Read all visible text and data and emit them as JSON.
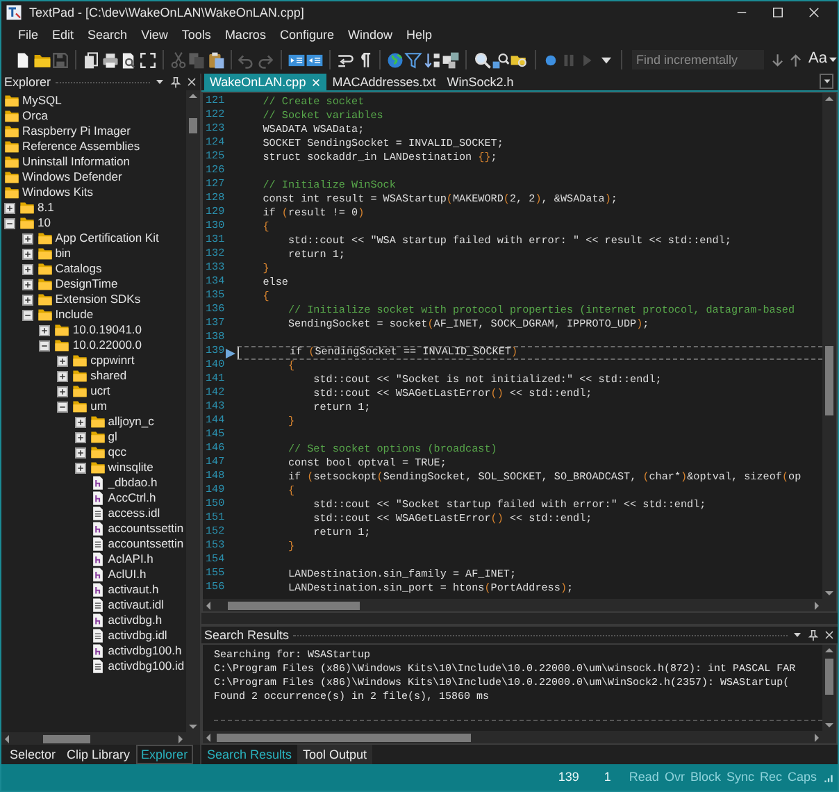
{
  "window": {
    "title": "TextPad - [C:\\dev\\WakeOnLAN\\WakeOnLAN.cpp]"
  },
  "menu": [
    "File",
    "Edit",
    "Search",
    "View",
    "Tools",
    "Macros",
    "Configure",
    "Window",
    "Help"
  ],
  "toolbar": {
    "groups": [
      [
        {
          "disabled": false
        },
        {
          "disabled": false
        },
        {
          "disabled": true
        }
      ],
      [
        {
          "disabled": false
        },
        {
          "disabled": false
        },
        {
          "disabled": false
        },
        {
          "disabled": false
        }
      ],
      [
        {
          "disabled": true
        },
        {
          "disabled": true
        },
        {
          "disabled": false
        }
      ],
      [
        {
          "disabled": true
        },
        {
          "disabled": true
        }
      ],
      [
        {
          "disabled": false
        },
        {
          "disabled": false
        }
      ],
      [
        {
          "disabled": false
        },
        {
          "disabled": false
        }
      ],
      [
        {
          "disabled": false
        },
        {
          "disabled": false
        },
        {
          "disabled": false
        },
        {
          "disabled": false
        }
      ],
      [
        {
          "disabled": false
        },
        {
          "disabled": false
        },
        {
          "disabled": false
        }
      ],
      [
        {
          "disabled": false
        },
        {
          "disabled": true
        },
        {
          "disabled": true
        },
        {
          "disabled": false
        }
      ]
    ],
    "find": {
      "placeholder": "Find incrementally"
    },
    "match_case": "Aa"
  },
  "explorer": {
    "title": "Explorer",
    "tree": [
      {
        "label": "MySQL",
        "kind": "folder"
      },
      {
        "label": "Orca",
        "kind": "folder"
      },
      {
        "label": "Raspberry Pi Imager",
        "kind": "folder"
      },
      {
        "label": "Reference Assemblies",
        "kind": "folder"
      },
      {
        "label": "Uninstall Information",
        "kind": "folder"
      },
      {
        "label": "Windows Defender",
        "kind": "folder"
      },
      {
        "label": "Windows Kits",
        "kind": "folder",
        "children": [
          {
            "label": "8.1",
            "kind": "folder",
            "expanded": false
          },
          {
            "label": "10",
            "kind": "folder",
            "expanded": true,
            "children": [
              {
                "label": "App Certification Kit",
                "kind": "folder",
                "expanded": false
              },
              {
                "label": "bin",
                "kind": "folder",
                "expanded": false
              },
              {
                "label": "Catalogs",
                "kind": "folder",
                "expanded": false
              },
              {
                "label": "DesignTime",
                "kind": "folder",
                "expanded": false
              },
              {
                "label": "Extension SDKs",
                "kind": "folder",
                "expanded": false
              },
              {
                "label": "Include",
                "kind": "folder",
                "expanded": true,
                "children": [
                  {
                    "label": "10.0.19041.0",
                    "kind": "folder",
                    "expanded": false
                  },
                  {
                    "label": "10.0.22000.0",
                    "kind": "folder",
                    "expanded": true,
                    "children": [
                      {
                        "label": "cppwinrt",
                        "kind": "folder",
                        "expanded": false
                      },
                      {
                        "label": "shared",
                        "kind": "folder",
                        "expanded": false
                      },
                      {
                        "label": "ucrt",
                        "kind": "folder",
                        "expanded": false
                      },
                      {
                        "label": "um",
                        "kind": "folder",
                        "expanded": true,
                        "children": [
                          {
                            "label": "alljoyn_c",
                            "kind": "folder",
                            "expanded": false
                          },
                          {
                            "label": "gl",
                            "kind": "folder",
                            "expanded": false
                          },
                          {
                            "label": "qcc",
                            "kind": "folder",
                            "expanded": false
                          },
                          {
                            "label": "winsqlite",
                            "kind": "folder",
                            "expanded": false
                          },
                          {
                            "label": "_dbdao.h",
                            "kind": "header"
                          },
                          {
                            "label": "AccCtrl.h",
                            "kind": "header"
                          },
                          {
                            "label": "access.idl",
                            "kind": "document"
                          },
                          {
                            "label": "accountssettin",
                            "kind": "header"
                          },
                          {
                            "label": "accountssettin",
                            "kind": "document"
                          },
                          {
                            "label": "AclAPI.h",
                            "kind": "header"
                          },
                          {
                            "label": "AclUI.h",
                            "kind": "header"
                          },
                          {
                            "label": "activaut.h",
                            "kind": "header"
                          },
                          {
                            "label": "activaut.idl",
                            "kind": "document"
                          },
                          {
                            "label": "activdbg.h",
                            "kind": "header"
                          },
                          {
                            "label": "activdbg.idl",
                            "kind": "document"
                          },
                          {
                            "label": "activdbg100.h",
                            "kind": "header"
                          },
                          {
                            "label": "activdbg100.id",
                            "kind": "document"
                          }
                        ]
                      }
                    ]
                  }
                ]
              }
            ]
          }
        ]
      }
    ],
    "tabs": [
      {
        "label": "Selector",
        "selected": false
      },
      {
        "label": "Clip Library",
        "selected": false
      },
      {
        "label": "Explorer",
        "selected": true
      }
    ]
  },
  "editor": {
    "tabs": [
      {
        "label": "WakeOnLAN.cpp",
        "selected": true
      },
      {
        "label": "MACAddresses.txt",
        "selected": false
      },
      {
        "label": "WinSock2.h",
        "selected": false
      }
    ],
    "lines": [
      {
        "number": "121",
        "kind": "comment",
        "text": "    // Create socket",
        "current": false
      },
      {
        "number": "122",
        "kind": "comment",
        "text": "    // Socket variables",
        "current": false
      },
      {
        "number": "123",
        "kind": "code",
        "text": "    WSADATA WSAData;",
        "current": false
      },
      {
        "number": "124",
        "kind": "code",
        "text": "    SOCKET SendingSocket = INVALID_SOCKET;",
        "current": false
      },
      {
        "number": "125",
        "kind": "code",
        "text": "    struct sockaddr_in LANDestination {};",
        "current": false
      },
      {
        "number": "126",
        "kind": "code",
        "current": false
      },
      {
        "number": "127",
        "kind": "comment",
        "text": "    // Initialize WinSock",
        "current": false
      },
      {
        "number": "128",
        "kind": "code",
        "text": "    const int result = WSAStartup(MAKEWORD(2, 2), &WSAData);",
        "current": false
      },
      {
        "number": "129",
        "kind": "code",
        "text": "    if (result != 0)",
        "current": false
      },
      {
        "number": "130",
        "kind": "code",
        "text": "    {",
        "current": false
      },
      {
        "number": "131",
        "kind": "code",
        "text": "        std::cout << \"WSA startup failed with error: \" << result << std::endl;",
        "current": false
      },
      {
        "number": "132",
        "kind": "code",
        "text": "        return 1;",
        "current": false
      },
      {
        "number": "133",
        "kind": "code",
        "text": "    }",
        "current": false
      },
      {
        "number": "134",
        "kind": "code",
        "text": "    else",
        "current": false
      },
      {
        "number": "135",
        "kind": "code",
        "text": "    {",
        "current": false
      },
      {
        "number": "136",
        "kind": "comment",
        "text": "        // Initialize socket with protocol properties (internet protocol, datagram-based",
        "current": false
      },
      {
        "number": "137",
        "kind": "code",
        "text": "        SendingSocket = socket(AF_INET, SOCK_DGRAM, IPPROTO_UDP);",
        "current": false
      },
      {
        "number": "138",
        "kind": "code",
        "current": false
      },
      {
        "number": "139",
        "kind": "code",
        "text": "        if (SendingSocket == INVALID_SOCKET)",
        "current": true
      },
      {
        "number": "140",
        "kind": "code",
        "text": "        {",
        "current": false
      },
      {
        "number": "141",
        "kind": "code",
        "text": "            std::cout << \"Socket is not initialized:\" << std::endl;",
        "current": false
      },
      {
        "number": "142",
        "kind": "code",
        "text": "            std::cout << WSAGetLastError() << std::endl;",
        "current": false
      },
      {
        "number": "143",
        "kind": "code",
        "text": "            return 1;",
        "current": false
      },
      {
        "number": "144",
        "kind": "code",
        "text": "        }",
        "current": false
      },
      {
        "number": "145",
        "kind": "code",
        "current": false
      },
      {
        "number": "146",
        "kind": "comment",
        "text": "        // Set socket options (broadcast)",
        "current": false
      },
      {
        "number": "147",
        "kind": "code",
        "text": "        const bool optval = TRUE;",
        "current": false
      },
      {
        "number": "148",
        "kind": "code",
        "text": "        if (setsockopt(SendingSocket, SOL_SOCKET, SO_BROADCAST, (char*)&optval, sizeof(op",
        "current": false
      },
      {
        "number": "149",
        "kind": "code",
        "text": "        {",
        "current": false
      },
      {
        "number": "150",
        "kind": "code",
        "text": "            std::cout << \"Socket startup failed with error:\" << std::endl;",
        "current": false
      },
      {
        "number": "151",
        "kind": "code",
        "text": "            std::cout << WSAGetLastError() << std::endl;",
        "current": false
      },
      {
        "number": "152",
        "kind": "code",
        "text": "            return 1;",
        "current": false
      },
      {
        "number": "153",
        "kind": "code",
        "text": "        }",
        "current": false
      },
      {
        "number": "154",
        "kind": "code",
        "current": false
      },
      {
        "number": "155",
        "kind": "code",
        "text": "        LANDestination.sin_family = AF_INET;",
        "current": false
      },
      {
        "number": "156",
        "kind": "code",
        "text": "        LANDestination.sin_port = htons(PortAddress);",
        "current": false
      }
    ]
  },
  "search_results": {
    "title": "Search Results",
    "lines": [
      "Searching for: WSAStartup",
      "C:\\Program Files (x86)\\Windows Kits\\10\\Include\\10.0.22000.0\\um\\winsock.h(872): int PASCAL FAR",
      "C:\\Program Files (x86)\\Windows Kits\\10\\Include\\10.0.22000.0\\um\\WinSock2.h(2357): WSAStartup(",
      "Found 2 occurrence(s) in 2 file(s), 15860 ms"
    ],
    "tabs": [
      {
        "label": "Search Results",
        "selected": true
      },
      {
        "label": "Tool Output",
        "selected": false
      }
    ]
  },
  "status_bar": {
    "line": "139",
    "column": "1",
    "indicators": [
      {
        "label": "Read",
        "on": false
      },
      {
        "label": "Ovr",
        "on": false
      },
      {
        "label": "Block",
        "on": false
      },
      {
        "label": "Sync",
        "on": false
      },
      {
        "label": "Rec",
        "on": false
      },
      {
        "label": "Caps",
        "on": false
      }
    ]
  }
}
